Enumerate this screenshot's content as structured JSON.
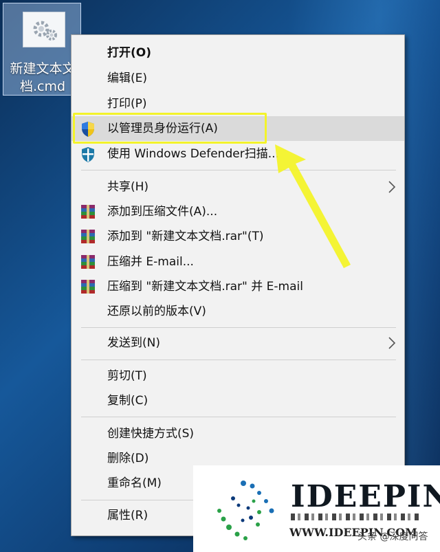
{
  "desktop": {
    "icon_label": "新建文本文档.cmd"
  },
  "context_menu": {
    "items": [
      {
        "label": "打开(O)",
        "bold": true
      },
      {
        "label": "编辑(E)"
      },
      {
        "label": "打印(P)"
      },
      {
        "label": "以管理员身份运行(A)",
        "icon": "uac-shield-icon",
        "highlighted": true
      },
      {
        "label": "使用 Windows Defender扫描...",
        "icon": "defender-icon"
      },
      {
        "label": "共享(H)",
        "submenu": true
      },
      {
        "label": "添加到压缩文件(A)...",
        "icon": "winrar-icon"
      },
      {
        "label": "添加到 \"新建文本文档.rar\"(T)",
        "icon": "winrar-icon"
      },
      {
        "label": "压缩并 E-mail...",
        "icon": "winrar-icon"
      },
      {
        "label": "压缩到 \"新建文本文档.rar\" 并 E-mail",
        "icon": "winrar-icon"
      },
      {
        "label": "还原以前的版本(V)"
      },
      {
        "label": "发送到(N)",
        "submenu": true
      },
      {
        "label": "剪切(T)"
      },
      {
        "label": "复制(C)"
      },
      {
        "label": "创建快捷方式(S)"
      },
      {
        "label": "删除(D)"
      },
      {
        "label": "重命名(M)"
      },
      {
        "label": "属性(R)"
      }
    ]
  },
  "watermark": {
    "brand": "IDEEPIN",
    "url": "WWW.IDEEPIN.COM",
    "source": "头条 @深度问答"
  },
  "colors": {
    "menu_bg": "#f2f2f2",
    "highlight_annotation": "#f3f32a",
    "hover_bg": "#dadada"
  }
}
